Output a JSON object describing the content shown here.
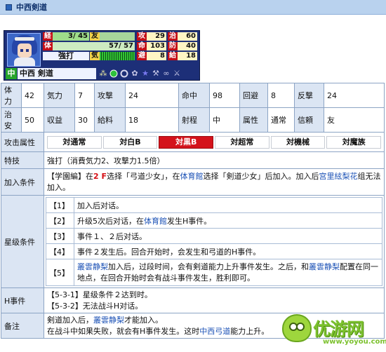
{
  "title": "中西剣道",
  "card": {
    "labels": {
      "exp": "経",
      "friend": "友",
      "hp": "体",
      "spirit": "気",
      "attack": "攻",
      "hit": "命",
      "evade": "避",
      "heal": "治",
      "defense": "防",
      "supply": "給"
    },
    "exp_value": "3/ 45",
    "hp_value": "57/ 57",
    "attack_value": "29",
    "hit_value": "103",
    "evade_value": "8",
    "heal_value": "60",
    "defense_value": "40",
    "supply_value": "18",
    "trait": "強打",
    "class_badge": "中",
    "class_name": "中西 剣道",
    "icons": [
      "stars-icon",
      "circle-icon",
      "ring-icon",
      "flower-icon",
      "star-icon",
      "wrench-icon",
      "link-icon",
      "sword-icon"
    ]
  },
  "stats": {
    "row1": [
      {
        "label": "体力",
        "value": "42"
      },
      {
        "label": "気力",
        "value": "7"
      },
      {
        "label": "攻撃",
        "value": "24"
      },
      {
        "label": "命中",
        "value": "98"
      },
      {
        "label": "回避",
        "value": "8"
      },
      {
        "label": "反撃",
        "value": "24"
      }
    ],
    "row2": [
      {
        "label": "治安",
        "value": "50"
      },
      {
        "label": "収益",
        "value": "30"
      },
      {
        "label": "給料",
        "value": "18"
      },
      {
        "label": "射程",
        "value": "中"
      },
      {
        "label": "属性",
        "value": "通常"
      },
      {
        "label": "信頼",
        "value": "友"
      }
    ]
  },
  "attack_attr": {
    "label": "攻击属性",
    "options": [
      "対通常",
      "対白B",
      "対黒B",
      "対超常",
      "対機械",
      "対魔族"
    ],
    "active_index": 2
  },
  "special": {
    "label": "特技",
    "value": "強打（消費気力2、攻撃力1.5倍）"
  },
  "join": {
    "label": "加入条件",
    "p1": "【学園編】在",
    "p2": "2 F",
    "p3": "选择「弓道少女」，在",
    "p4": "体育館",
    "p5": "选择「剣道少女」后加入。加入后",
    "p6": "宫里絃梨花",
    "p7": "组无法加入。"
  },
  "star": {
    "label": "星级条件",
    "rows": [
      {
        "key": "【1】",
        "text": "加入后对话。"
      },
      {
        "key": "【2】",
        "a": "升级5次后对话，在",
        "b": "体育館",
        "c": "发生H事件。"
      },
      {
        "key": "【3】",
        "text": "事件１、２后对话。"
      },
      {
        "key": "【4】",
        "text": "事件２发生后。回合开始时，会发生和弓道的H事件。"
      },
      {
        "key": "【5】",
        "a": "叢雲静梨",
        "b": "加入后，过段时间，会有剣道能力上升事件发生。之后，和",
        "c": "叢雲静梨",
        "d": "配置在同一地点，在回合开始时会有战斗事件发生，胜利即可。"
      }
    ]
  },
  "h_event": {
    "label": "H事件",
    "line1": "【5-3-1】星级条件２达到时。",
    "line2": "【5-3-2】无法战斗H对话。"
  },
  "note": {
    "label": "备注",
    "a": "剣道加入后，",
    "b": "叢雲静梨",
    "c": "才能加入。",
    "d": "在战斗中如果失败，就会有H事件发生。这时",
    "e": "中西弓道",
    "f": "能力上升。"
  },
  "watermark": {
    "brand": "优游网",
    "url": "www.yoyou.com"
  }
}
